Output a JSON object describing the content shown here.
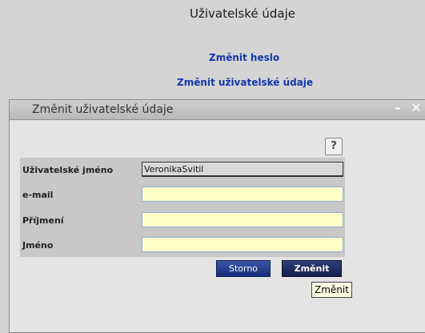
{
  "page": {
    "title": "Uživatelské údaje",
    "links": [
      {
        "label": "Změnit heslo"
      },
      {
        "label": "Změnit uživatelské údaje"
      }
    ]
  },
  "dialog": {
    "title": "Změnit uživatelské údaje",
    "help_label": "?",
    "fields": [
      {
        "label": "Uživatelské jméno",
        "value": "VeronikaSvitil",
        "readonly": true
      },
      {
        "label": "e-mail",
        "value": ""
      },
      {
        "label": "Příjmení",
        "value": ""
      },
      {
        "label": "Jméno",
        "value": ""
      }
    ],
    "buttons": {
      "cancel_label": "Storno",
      "submit_label": "Změnit"
    },
    "tooltip": "Změnit"
  },
  "colors": {
    "link": "#1238a8",
    "input_bg": "#fdfdc8",
    "button": "#1f3a86"
  }
}
